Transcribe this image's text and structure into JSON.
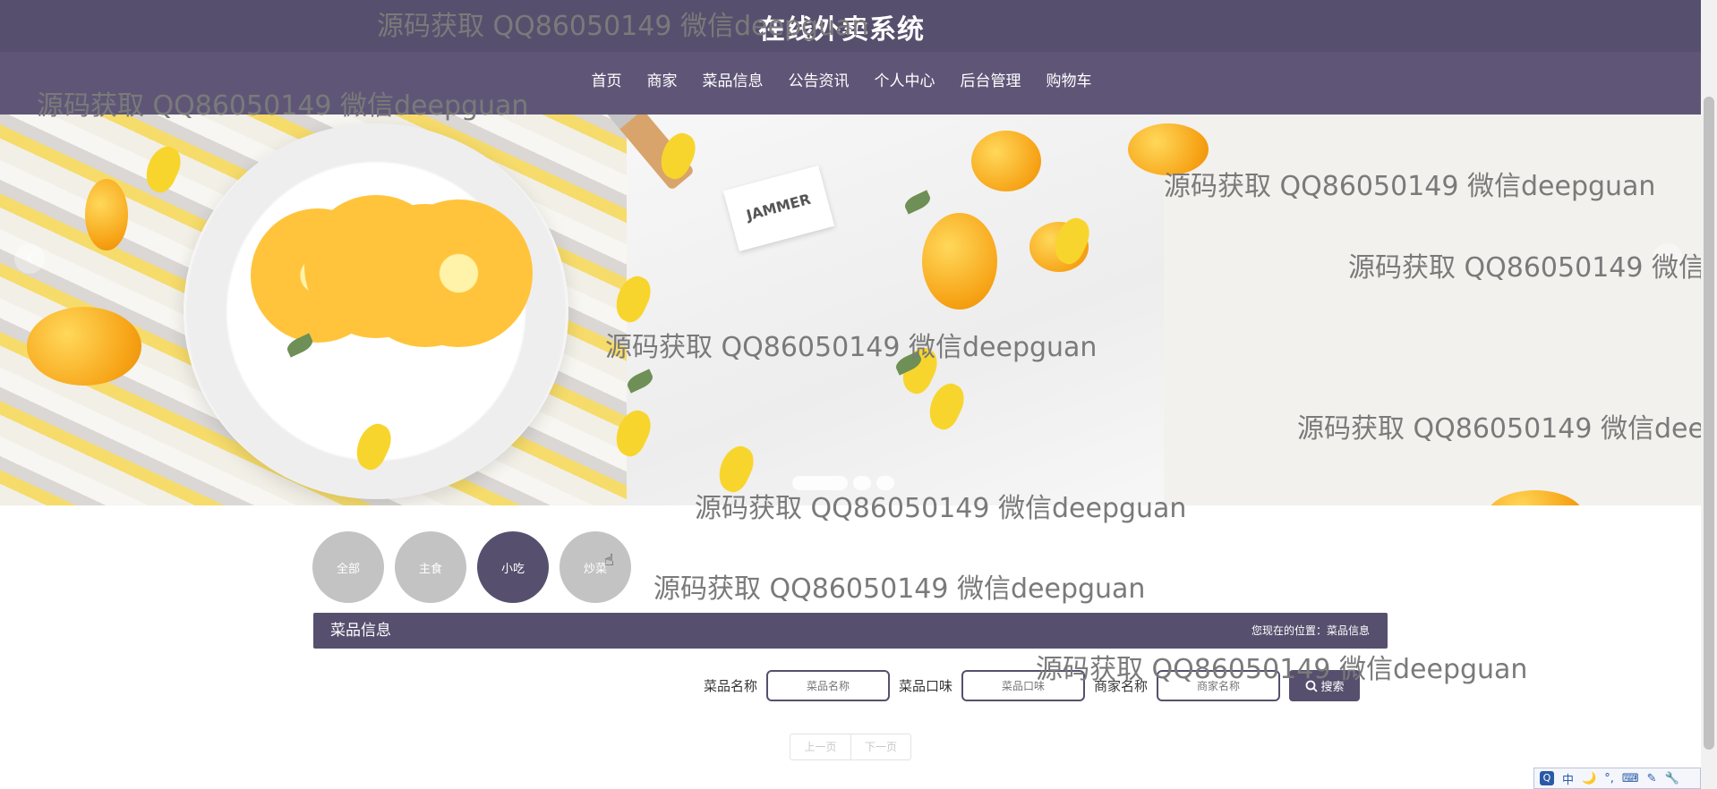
{
  "header": {
    "site_title": "在线外卖系统",
    "nav": [
      "首页",
      "商家",
      "菜品信息",
      "公告资讯",
      "个人中心",
      "后台管理",
      "购物车"
    ]
  },
  "banner": {
    "prev_glyph": "‹",
    "next_glyph": "›",
    "slides": [
      1,
      2,
      3
    ],
    "label": "JAMMER",
    "active_slide": 1
  },
  "categories": {
    "items": [
      "全部",
      "主食",
      "小吃",
      "炒菜"
    ],
    "active_index": 2
  },
  "section": {
    "title": "菜品信息",
    "breadcrumb_prefix": "您现在的位置：",
    "breadcrumb_current": "菜品信息"
  },
  "search": {
    "fields": [
      {
        "label": "菜品名称",
        "placeholder": "菜品名称"
      },
      {
        "label": "菜品口味",
        "placeholder": "菜品口味"
      },
      {
        "label": "商家名称",
        "placeholder": "商家名称"
      }
    ],
    "button_label": "搜索",
    "button_icon": "search-icon"
  },
  "pagination": {
    "prev": "上一页",
    "next": "下一页"
  },
  "watermark": "源码获取 QQ86050149 微信deepguan",
  "ime": {
    "items": [
      "中",
      "🌙",
      "°,",
      "⌨",
      "✎",
      "🔧"
    ]
  },
  "colors": {
    "primary": "#574f6e",
    "nav_bg": "#5f5677",
    "category_inactive": "#c3c3c3"
  }
}
